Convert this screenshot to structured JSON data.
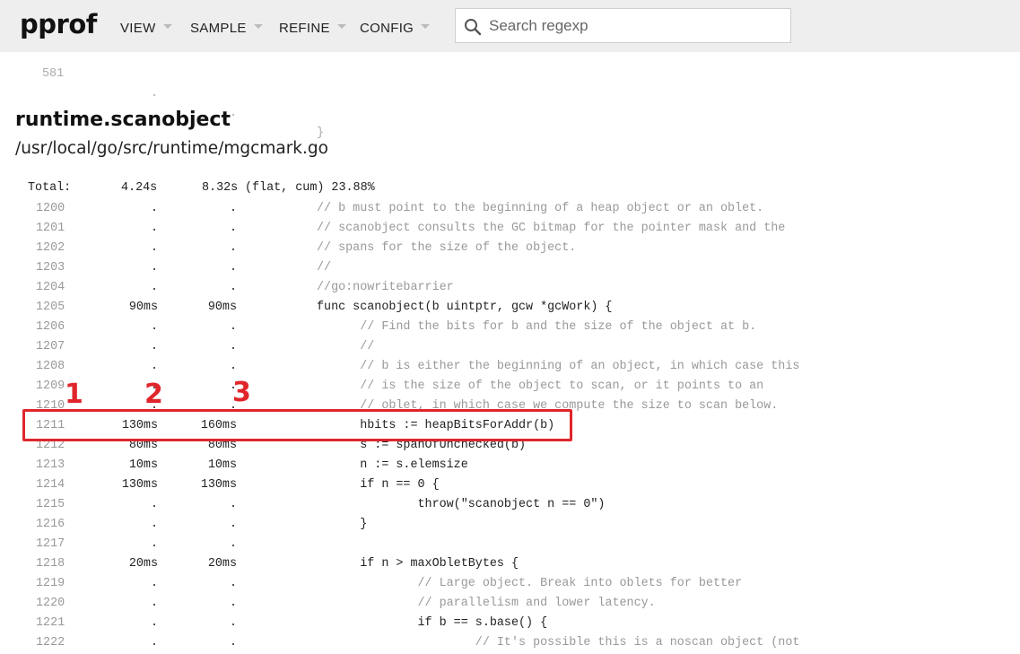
{
  "app": {
    "logo": "pprof"
  },
  "header": {
    "menus": [
      {
        "label": "VIEW"
      },
      {
        "label": "SAMPLE"
      },
      {
        "label": "REFINE"
      },
      {
        "label": "CONFIG"
      }
    ],
    "search": {
      "placeholder": "Search regexp",
      "value": ""
    }
  },
  "prev_row": {
    "line": "581",
    "flat": ".",
    "cum": ".",
    "code": "}"
  },
  "function": {
    "name": "runtime.scanobject",
    "path": "/usr/local/go/src/runtime/mgcmark.go",
    "total_label": "Total:",
    "total_flat": "4.24s",
    "total_cum": "8.32s",
    "total_suffix": "(flat, cum) 23.88%"
  },
  "rows": [
    {
      "line": "1200",
      "flat": ".",
      "cum": ".",
      "code": "// b must point to the beginning of a heap object or an oblet."
    },
    {
      "line": "1201",
      "flat": ".",
      "cum": ".",
      "code": "// scanobject consults the GC bitmap for the pointer mask and the"
    },
    {
      "line": "1202",
      "flat": ".",
      "cum": ".",
      "code": "// spans for the size of the object."
    },
    {
      "line": "1203",
      "flat": ".",
      "cum": ".",
      "code": "//"
    },
    {
      "line": "1204",
      "flat": ".",
      "cum": ".",
      "code": "//go:nowritebarrier"
    },
    {
      "line": "1205",
      "flat": "90ms",
      "cum": "90ms",
      "code": "func scanobject(b uintptr, gcw *gcWork) {"
    },
    {
      "line": "1206",
      "flat": ".",
      "cum": ".",
      "code": "      // Find the bits for b and the size of the object at b."
    },
    {
      "line": "1207",
      "flat": ".",
      "cum": ".",
      "code": "      //"
    },
    {
      "line": "1208",
      "flat": ".",
      "cum": ".",
      "code": "      // b is either the beginning of an object, in which case this"
    },
    {
      "line": "1209",
      "flat": ".",
      "cum": ".",
      "code": "      // is the size of the object to scan, or it points to an"
    },
    {
      "line": "1210",
      "flat": ".",
      "cum": ".",
      "code": "      // oblet, in which case we compute the size to scan below."
    },
    {
      "line": "1211",
      "flat": "130ms",
      "cum": "160ms",
      "code": "      hbits := heapBitsForAddr(b)"
    },
    {
      "line": "1212",
      "flat": "80ms",
      "cum": "80ms",
      "code": "      s := spanOfUnchecked(b)"
    },
    {
      "line": "1213",
      "flat": "10ms",
      "cum": "10ms",
      "code": "      n := s.elemsize"
    },
    {
      "line": "1214",
      "flat": "130ms",
      "cum": "130ms",
      "code": "      if n == 0 {"
    },
    {
      "line": "1215",
      "flat": ".",
      "cum": ".",
      "code": "              throw(\"scanobject n == 0\")"
    },
    {
      "line": "1216",
      "flat": ".",
      "cum": ".",
      "code": "      }"
    },
    {
      "line": "1217",
      "flat": ".",
      "cum": ".",
      "code": ""
    },
    {
      "line": "1218",
      "flat": "20ms",
      "cum": "20ms",
      "code": "      if n > maxObletBytes {"
    },
    {
      "line": "1219",
      "flat": ".",
      "cum": ".",
      "code": "              // Large object. Break into oblets for better"
    },
    {
      "line": "1220",
      "flat": ".",
      "cum": ".",
      "code": "              // parallelism and lower latency."
    },
    {
      "line": "1221",
      "flat": ".",
      "cum": ".",
      "code": "              if b == s.base() {"
    },
    {
      "line": "1222",
      "flat": ".",
      "cum": ".",
      "code": "                      // It's possible this is a noscan object (not"
    }
  ],
  "annotation": {
    "color": "#e0262b",
    "labels": [
      "1",
      "2",
      "3"
    ],
    "highlight_line": "1211"
  }
}
